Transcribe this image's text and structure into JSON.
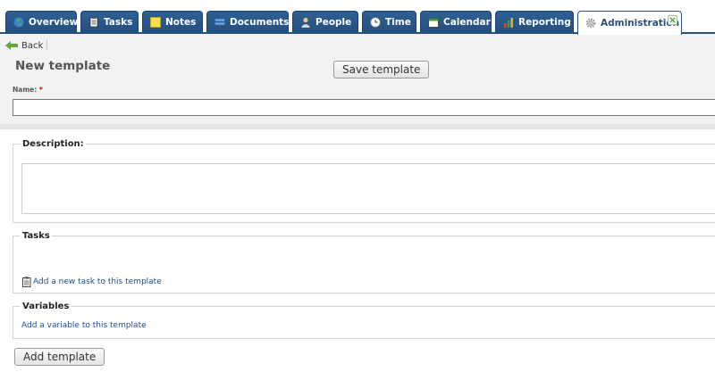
{
  "tabs": [
    {
      "label": "Overview",
      "icon": "globe-icon",
      "name": "tab-overview"
    },
    {
      "label": "Tasks",
      "icon": "task-list-icon",
      "name": "tab-tasks"
    },
    {
      "label": "Notes",
      "icon": "note-icon",
      "name": "tab-notes"
    },
    {
      "label": "Documents",
      "icon": "document-stack-icon",
      "name": "tab-documents"
    },
    {
      "label": "People",
      "icon": "person-icon",
      "name": "tab-people"
    },
    {
      "label": "Time",
      "icon": "clock-icon",
      "name": "tab-time"
    },
    {
      "label": "Calendar",
      "icon": "calendar-icon",
      "name": "tab-calendar"
    },
    {
      "label": "Reporting",
      "icon": "bar-chart-icon",
      "name": "tab-reporting"
    },
    {
      "label": "Administration",
      "icon": "gear-icon",
      "name": "tab-administration",
      "active": true
    }
  ],
  "nav": {
    "back_label": "Back"
  },
  "page": {
    "title": "New template",
    "save_label": "Save template"
  },
  "form": {
    "name_label": "Name:",
    "required_marker": "*",
    "name_value": ""
  },
  "description": {
    "legend": "Description:",
    "value": ""
  },
  "tasks": {
    "legend": "Tasks",
    "add_link": "Add a new task to this template"
  },
  "variables": {
    "legend": "Variables",
    "add_link": "Add a variable to this template"
  },
  "footer": {
    "add_label": "Add template"
  },
  "colors": {
    "tab_bg": "#2f5f94",
    "tab_border": "#1c4370",
    "link": "#1d4e8f",
    "required": "#dd0000",
    "form_bg": "#f2f2f2"
  }
}
